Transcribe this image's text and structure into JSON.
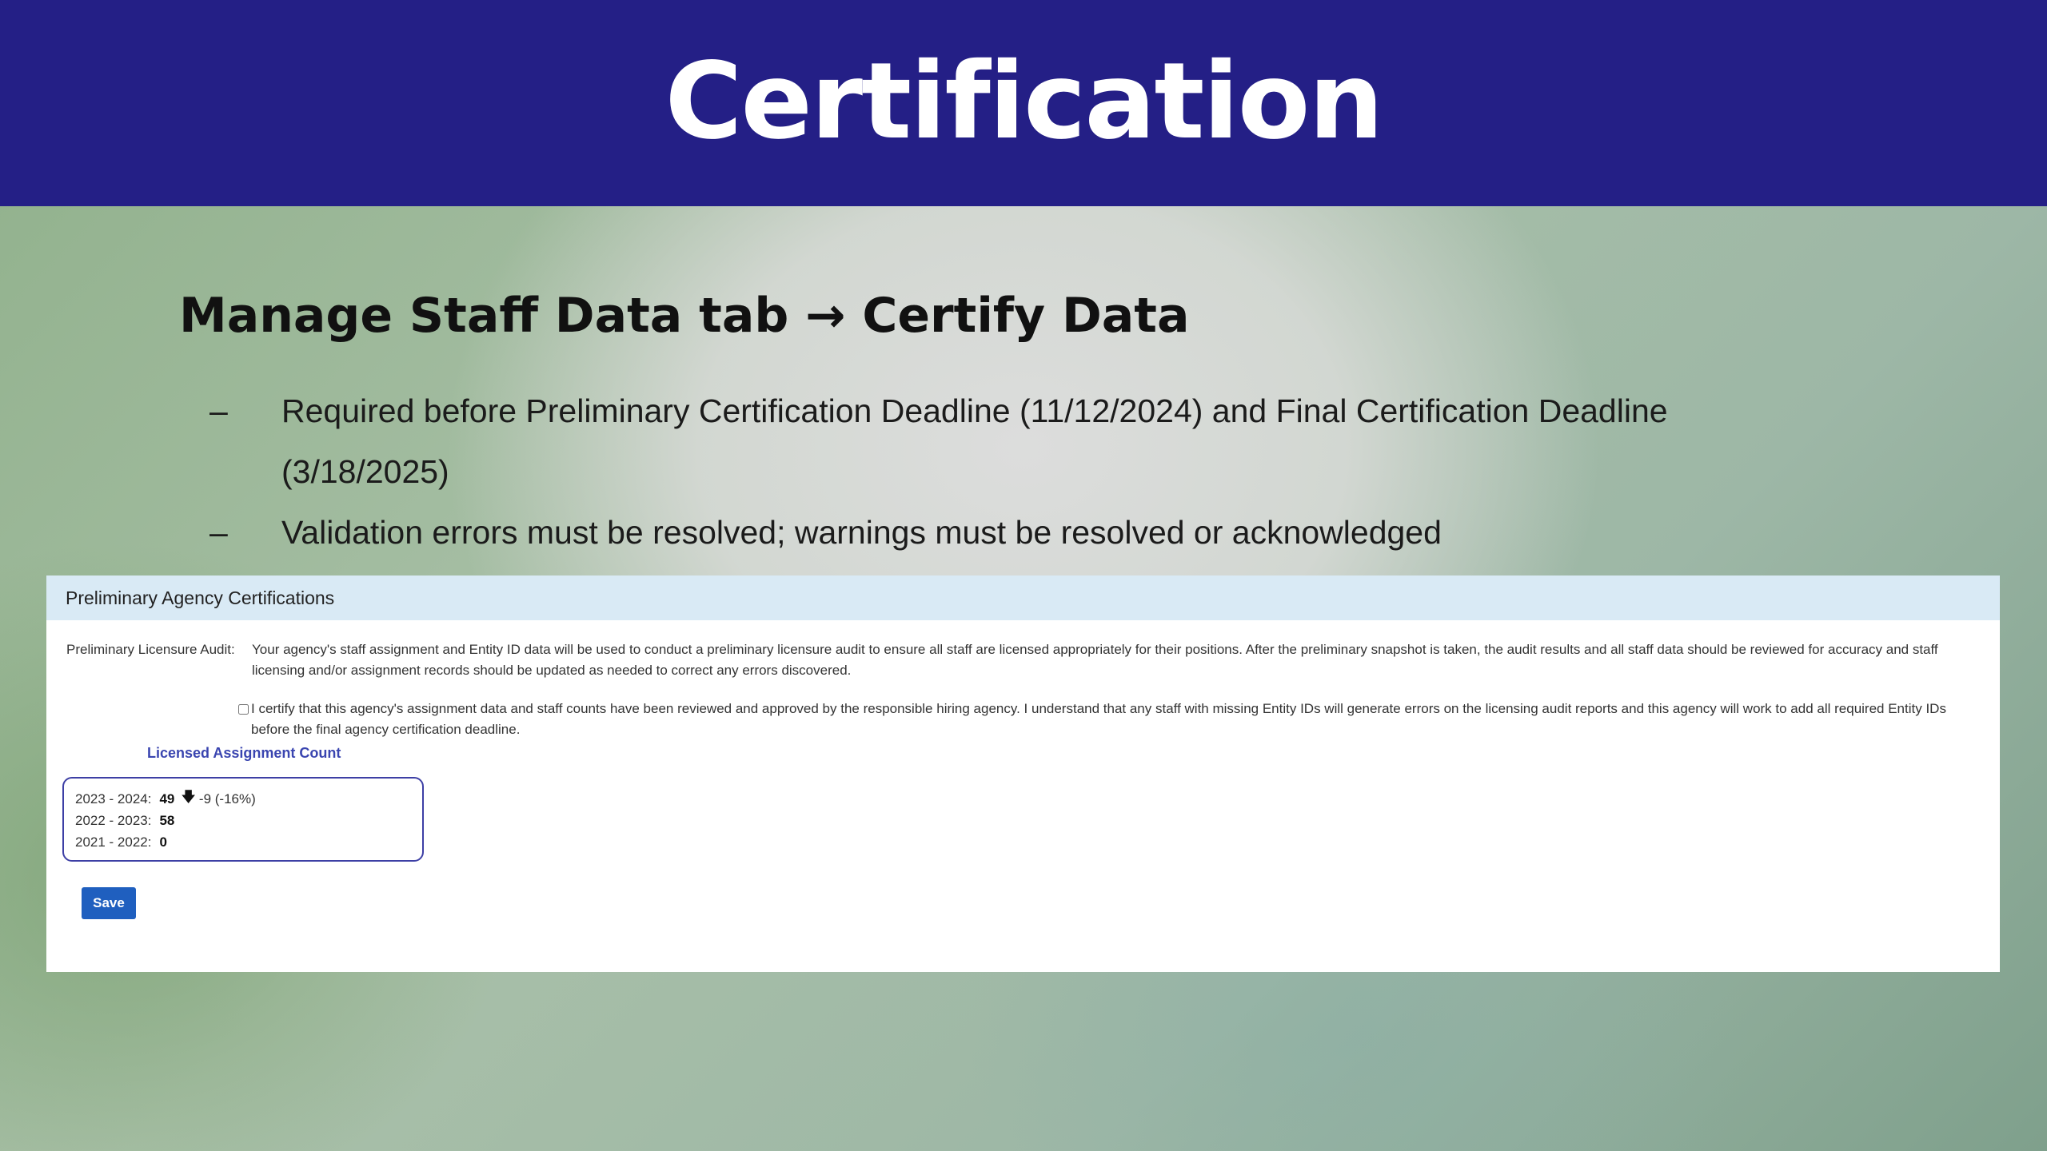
{
  "slide": {
    "title": "Certification",
    "subtitle": "Manage Staff Data tab → Certify Data",
    "bullets": [
      {
        "dash": "–",
        "text": "Required before Preliminary Certification Deadline (11/12/2024) and Final Certification Deadline (3/18/2025)"
      },
      {
        "dash": "–",
        "text": "Validation errors must be resolved; warnings must be resolved or acknowledged"
      }
    ]
  },
  "panel": {
    "header": "Preliminary Agency Certifications",
    "audit_label": "Preliminary Licensure Audit:",
    "audit_text": "Your agency's staff assignment and Entity ID data will be used to conduct a preliminary licensure audit to ensure all staff are licensed appropriately for their positions. After the preliminary snapshot is taken, the audit results and all staff data should be reviewed for accuracy and staff licensing and/or assignment records should be updated as needed to correct any errors discovered.",
    "certify_checked": false,
    "certify_text": "I certify that this agency's assignment data and staff counts have been reviewed and approved by the responsible hiring agency. I understand that any staff with missing Entity IDs will generate errors on the licensing audit reports and this agency will work to add all required Entity IDs before the final agency certification deadline.",
    "licensed_title": "Licensed Assignment Count",
    "counts": [
      {
        "year": "2023 - 2024:",
        "value": "49",
        "change": "-9 (-16%)"
      },
      {
        "year": "2022 - 2023:",
        "value": "58",
        "change": ""
      },
      {
        "year": "2021 - 2022:",
        "value": "0",
        "change": ""
      }
    ],
    "save_label": "Save"
  },
  "colors": {
    "header_bg": "#241f86",
    "panel_header_bg": "#d9eaf5",
    "accent": "#3d3fa5",
    "button": "#1f5fbf"
  }
}
